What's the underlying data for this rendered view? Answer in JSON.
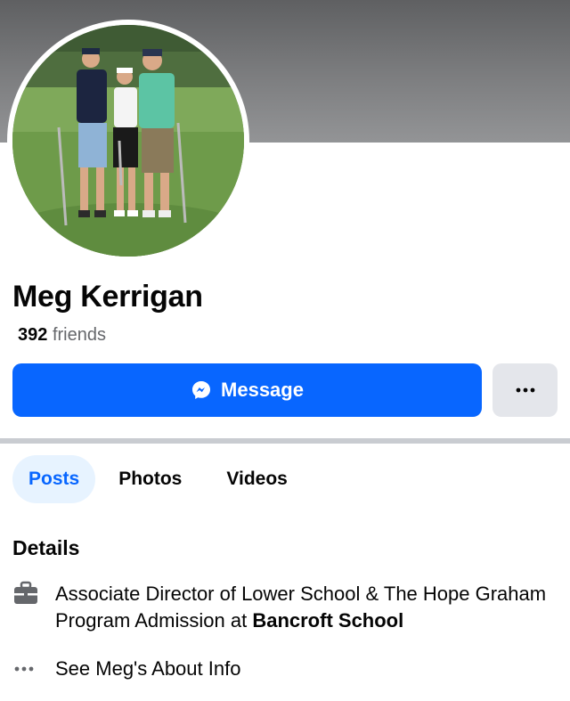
{
  "profile": {
    "name": "Meg Kerrigan",
    "friends_count": "392",
    "friends_label": "friends"
  },
  "actions": {
    "message_label": "Message",
    "more_label": "···"
  },
  "tabs": [
    {
      "label": "Posts",
      "active": true
    },
    {
      "label": "Photos",
      "active": false
    },
    {
      "label": "Videos",
      "active": false
    }
  ],
  "details": {
    "title": "Details",
    "work": {
      "prefix": "Associate Director of Lower School & The Hope Graham Program Admission at",
      "org": "Bancroft School"
    },
    "about_link": "See Meg's About Info"
  },
  "icons": {
    "message": "messenger-icon",
    "more": "more-dots-icon",
    "work": "briefcase-icon",
    "about": "ellipsis-icon"
  },
  "colors": {
    "primary": "#0866ff",
    "tab_active_bg": "#e7f3ff",
    "secondary_button": "#e4e6eb",
    "muted_text": "#65676b"
  }
}
